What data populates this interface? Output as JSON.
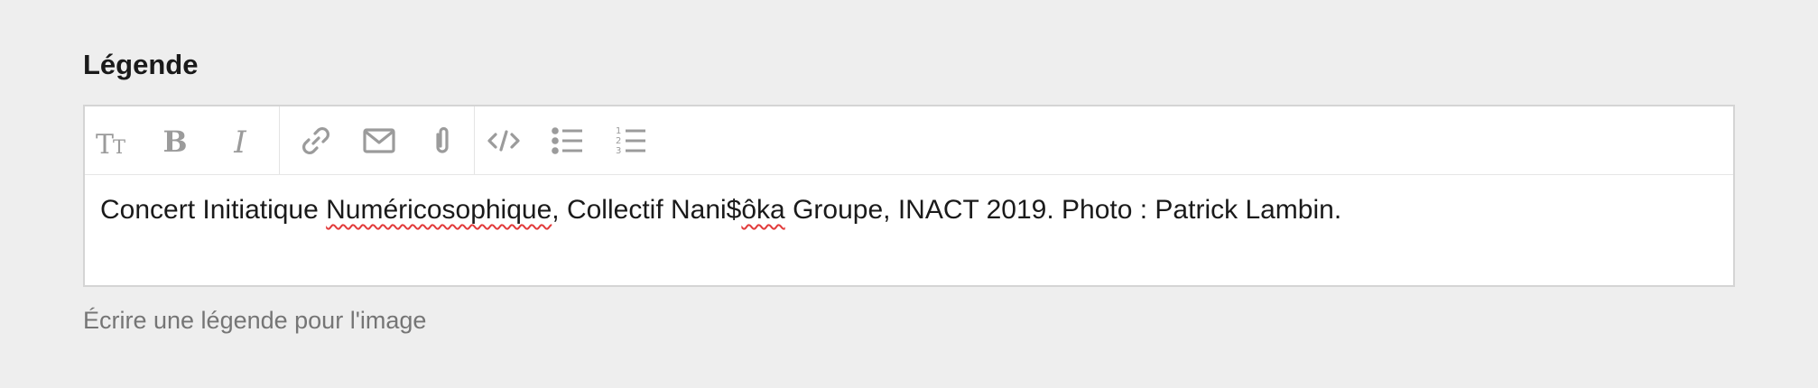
{
  "field": {
    "label": "Légende",
    "help_text": "Écrire une légende pour l'image"
  },
  "toolbar": {
    "icon_color": "#9b9b9b",
    "groups": [
      {
        "tools": [
          {
            "name": "text-size-icon",
            "glyph": "TT"
          },
          {
            "name": "bold-icon",
            "glyph": "B"
          },
          {
            "name": "italic-icon",
            "glyph": "I"
          }
        ]
      },
      {
        "tools": [
          {
            "name": "link-icon"
          },
          {
            "name": "email-icon"
          },
          {
            "name": "attachment-icon"
          }
        ]
      },
      {
        "tools": [
          {
            "name": "code-icon"
          },
          {
            "name": "bullet-list-icon"
          },
          {
            "name": "numbered-list-icon",
            "numbers": [
              "1",
              "2",
              "3"
            ]
          }
        ]
      }
    ]
  },
  "editor": {
    "segments": [
      {
        "text": "Concert Initiatique ",
        "misspelled": false
      },
      {
        "text": "Numéricosophique",
        "misspelled": true
      },
      {
        "text": ", Collectif Nani$",
        "misspelled": false
      },
      {
        "text": "ôka",
        "misspelled": true
      },
      {
        "text": " Groupe, INACT 2019. Photo : Patrick Lambin.",
        "misspelled": false
      }
    ]
  },
  "colors": {
    "background": "#eeeeee",
    "border": "#d4d4d4",
    "spellcheck": "#e23b3b"
  }
}
